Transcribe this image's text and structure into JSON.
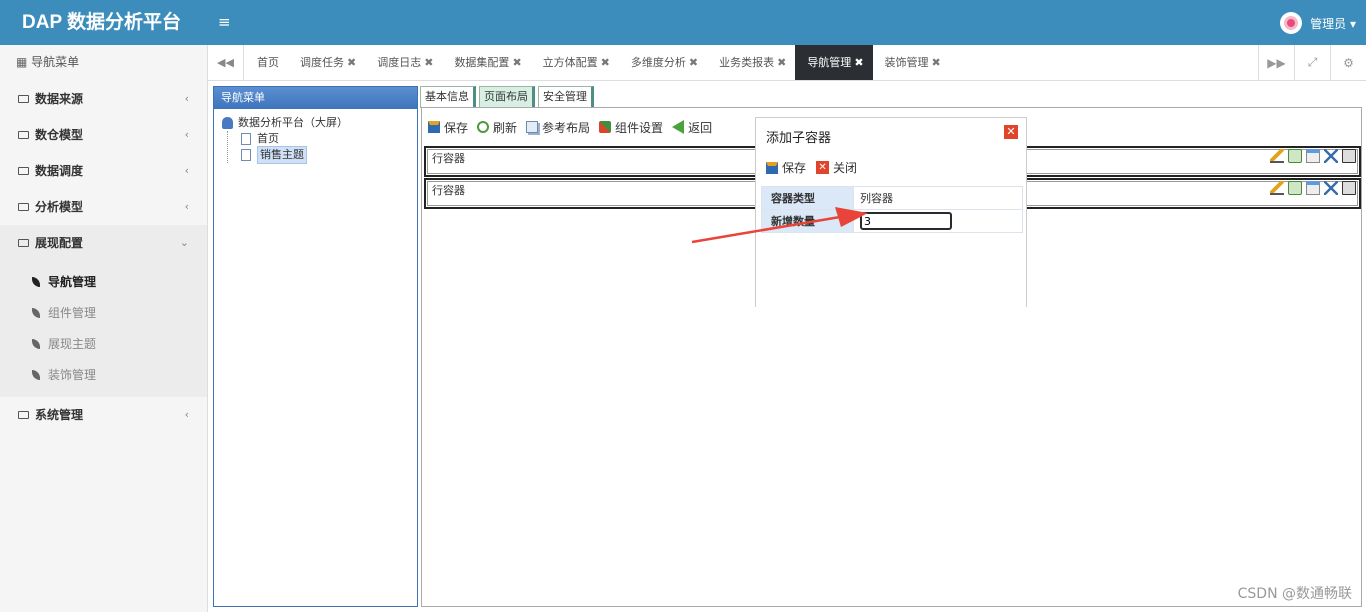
{
  "app": {
    "brand": "DAP 数据分析平台",
    "menu_icon": "≡",
    "user": "管理员 ▾"
  },
  "sidebar": {
    "header": "导航菜单",
    "items": [
      {
        "label": "数据来源",
        "chevron": "‹"
      },
      {
        "label": "数仓模型",
        "chevron": "‹"
      },
      {
        "label": "数据调度",
        "chevron": "‹"
      },
      {
        "label": "分析模型",
        "chevron": "‹"
      },
      {
        "label": "展现配置",
        "chevron": "⌄"
      },
      {
        "label": "系统管理",
        "chevron": "‹"
      }
    ],
    "sub_items": [
      "导航管理",
      "组件管理",
      "展现主题",
      "装饰管理"
    ]
  },
  "tabs": {
    "items": [
      "首页",
      "调度任务",
      "调度日志",
      "数据集配置",
      "立方体配置",
      "多维度分析",
      "业务类报表",
      "导航管理",
      "装饰管理"
    ],
    "close": "✖"
  },
  "nav_panel": {
    "title": "导航菜单",
    "root": "数据分析平台（大屏）",
    "children": [
      "首页",
      "销售主题"
    ]
  },
  "subtabs": [
    "基本信息",
    "页面布局",
    "安全管理"
  ],
  "toolbar": [
    "保存",
    "刷新",
    "参考布局",
    "组件设置",
    "返回"
  ],
  "rows": [
    {
      "label": "行容器"
    },
    {
      "label": "行容器"
    }
  ],
  "dialog": {
    "title": "添加子容器",
    "save": "保存",
    "close": "关闭",
    "type_label": "容器类型",
    "type_value": "列容器",
    "count_label": "新增数量",
    "count_value": "3"
  },
  "watermark": "CSDN @数通畅联",
  "colors": {
    "header": "#3c8dbc",
    "active_tab": "#2b2f33",
    "arrow": "#e8443a"
  }
}
